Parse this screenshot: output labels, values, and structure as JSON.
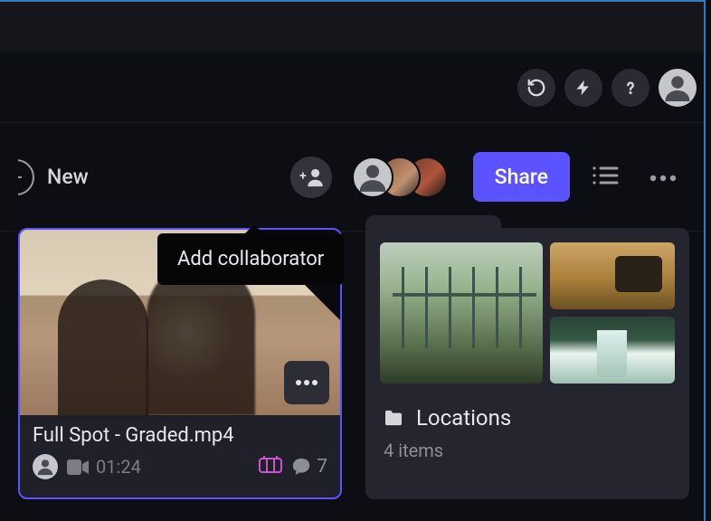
{
  "toolbar": {
    "new_label": "New",
    "share_label": "Share"
  },
  "tooltip": {
    "add_collaborator": "Add collaborator"
  },
  "asset": {
    "title": "Full Spot - Graded.mp4",
    "duration": "01:24",
    "comment_count": "7"
  },
  "folder": {
    "name": "Locations",
    "item_count": "4 items"
  }
}
